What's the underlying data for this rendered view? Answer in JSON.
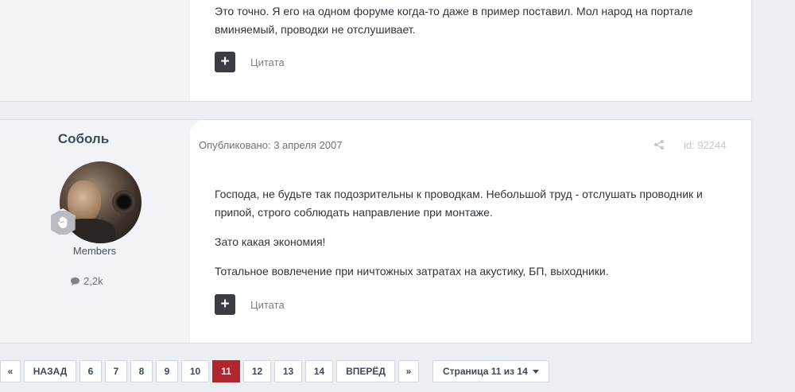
{
  "top_post": {
    "paragraphs": [
      "Это точно. Я его на одном форуме когда-то даже в пример поставил. Мол народ на портале вминяемый, проводки не отслушивает."
    ],
    "quote_label": "Цитата",
    "multiquote_icon": "plus-icon"
  },
  "main_post": {
    "author": {
      "name": "Соболь",
      "group": "Members",
      "reputation": "2,2k",
      "rank_icon": "hand-icon",
      "reputation_icon": "comment-icon"
    },
    "published": "Опубликовано: 3 апреля 2007",
    "post_id": "id: 92244",
    "share_icon": "share-icon",
    "paragraphs": [
      "Господа, не будьте так подозрительны к проводкам. Небольшой труд - отслушать проводник и припой, строго соблюдать направление при монтаже.",
      "Зато какая экономия!",
      "Тотальное вовлечение при ничтожных затратах на акустику, БП, выходники."
    ],
    "quote_label": "Цитата",
    "multiquote_icon": "plus-icon"
  },
  "pagination": {
    "first": "«",
    "prev": "НАЗАД",
    "pages": [
      "6",
      "7",
      "8",
      "9",
      "10",
      "11",
      "12",
      "13",
      "14"
    ],
    "current": "11",
    "next": "ВПЕРЁД",
    "last": "»",
    "page_jump": "Страница 11 из 14"
  },
  "colors": {
    "accent": "#b0262e",
    "background": "#ebeef2",
    "author_column": "#f1f3f6"
  }
}
